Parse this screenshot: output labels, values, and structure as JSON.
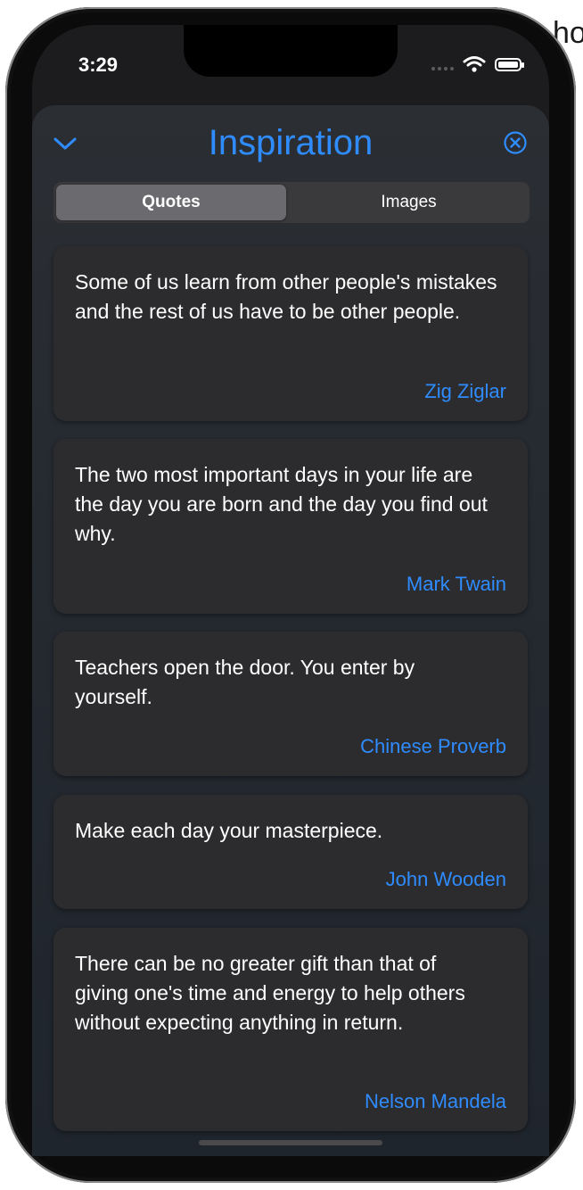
{
  "status_bar": {
    "time": "3:29"
  },
  "header": {
    "title": "Inspiration"
  },
  "segments": {
    "items": [
      {
        "label": "Quotes"
      },
      {
        "label": "Images"
      }
    ],
    "selected": "Quotes"
  },
  "quotes": [
    {
      "text": "Some of us learn from other people's mistakes and the rest of us have to be other people.",
      "author": "Zig Ziglar"
    },
    {
      "text": "The two most important days in your life are the day you are born and the day you find out why.",
      "author": "Mark Twain"
    },
    {
      "text": "Teachers open the door. You enter by yourself.",
      "author": "Chinese Proverb"
    },
    {
      "text": "Make each day your masterpiece.",
      "author": "John Wooden"
    },
    {
      "text": "There can be no greater gift than that of giving one's time and energy to help others without expecting anything in return.",
      "author": "Nelson Mandela"
    }
  ],
  "colors": {
    "accent": "#2f8cff",
    "card": "#2c2c2e",
    "sheet": "#282b30"
  },
  "icons": {
    "back": "chevron-down-icon",
    "close": "close-circle-icon",
    "wifi": "wifi-icon",
    "battery": "battery-icon",
    "signal": "cellular-signal-icon"
  }
}
